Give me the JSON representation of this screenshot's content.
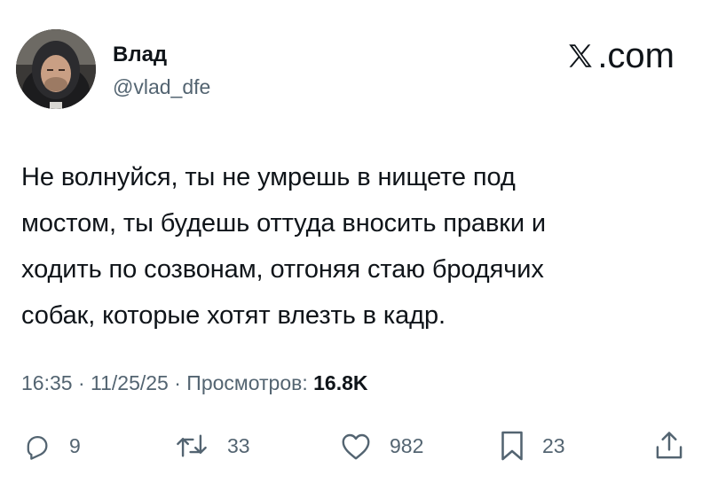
{
  "author": {
    "display_name": "Влад",
    "handle": "@vlad_dfe",
    "avatar_icon": "avatar-photo"
  },
  "brand": {
    "label": ".com",
    "icon": "x-logo-icon"
  },
  "tweet": {
    "text_lines": [
      "Не волнуйся, ты не умрешь в нищете под",
      "мостом, ты будешь оттуда вносить правки и",
      "ходить по созвонам, отгоняя стаю бродячих",
      "собак, которые хотят влезть в кадр."
    ]
  },
  "meta": {
    "time": "16:35",
    "separator": " · ",
    "date": "11/25/25",
    "views_label": "Просмотров: ",
    "views_count": "16.8K"
  },
  "actions": {
    "replies": {
      "icon": "reply-icon",
      "count": "9"
    },
    "reposts": {
      "icon": "repost-icon",
      "count": "33"
    },
    "likes": {
      "icon": "heart-icon",
      "count": "982"
    },
    "bookmarks": {
      "icon": "bookmark-icon",
      "count": "23"
    },
    "share": {
      "icon": "share-icon"
    }
  },
  "colors": {
    "text": "#0f1419",
    "secondary": "#536471",
    "background": "#ffffff"
  }
}
